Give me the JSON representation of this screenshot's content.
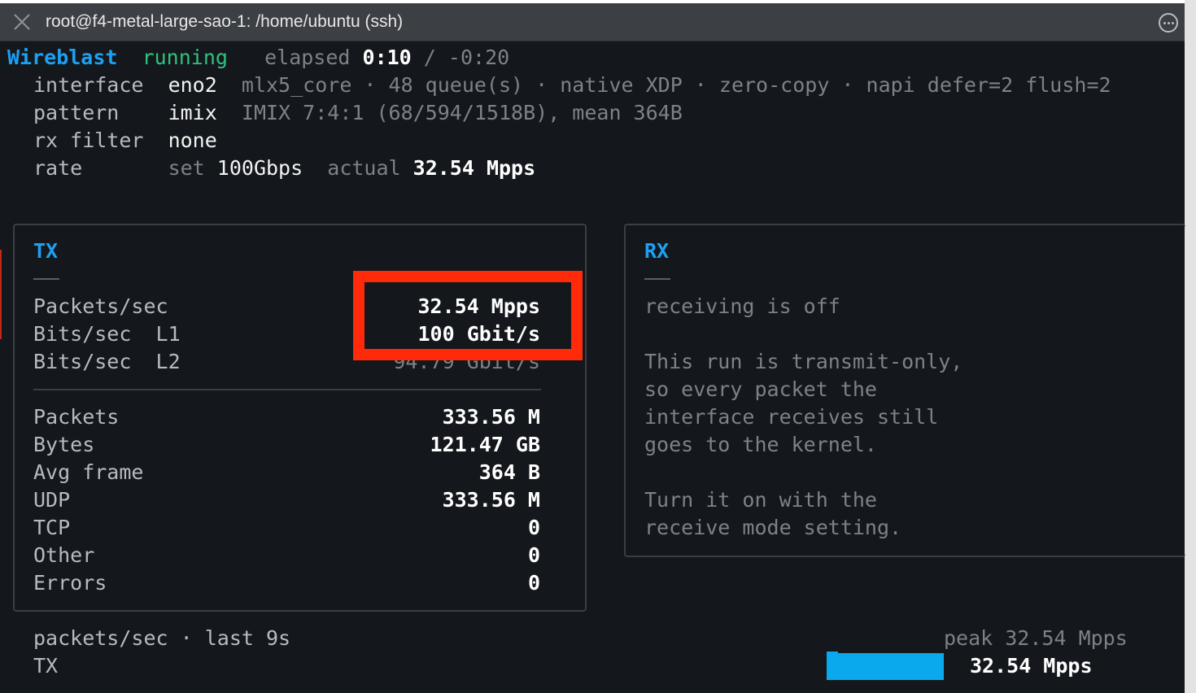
{
  "window": {
    "title": "root@f4-metal-large-sao-1: /home/ubuntu (ssh)"
  },
  "header": {
    "app": "Wireblast",
    "status": "running",
    "elapsed_label": "elapsed",
    "elapsed": "0:10",
    "sep": "/",
    "remaining": "-0:20"
  },
  "info": {
    "interface_label": "interface",
    "interface": "eno2",
    "interface_detail": "mlx5_core · 48 queue(s) · native XDP · zero-copy · napi defer=2 flush=2",
    "pattern_label": "pattern",
    "pattern": "imix",
    "pattern_detail": "IMIX 7:4:1 (68/594/1518B), mean 364B",
    "rx_filter_label": "rx filter",
    "rx_filter": "none",
    "rate_label": "rate",
    "rate_set_label": "set",
    "rate_set": "100Gbps",
    "rate_actual_label": "actual",
    "rate_actual": "32.54 Mpps"
  },
  "tx": {
    "title": "TX",
    "rates": [
      {
        "label": "Packets/sec",
        "value": "32.54 Mpps"
      },
      {
        "label": "Bits/sec  L1",
        "value": "100 Gbit/s"
      },
      {
        "label": "Bits/sec  L2",
        "value": "94.79 Gbit/s"
      }
    ],
    "counters": [
      {
        "label": "Packets",
        "value": "333.56 M"
      },
      {
        "label": "Bytes",
        "value": "121.47 GB"
      },
      {
        "label": "Avg frame",
        "value": "364 B"
      },
      {
        "label": "UDP",
        "value": "333.56 M"
      },
      {
        "label": "TCP",
        "value": "0"
      },
      {
        "label": "Other",
        "value": "0"
      },
      {
        "label": "Errors",
        "value": "0"
      }
    ]
  },
  "rx": {
    "title": "RX",
    "line1": "receiving is off",
    "para1": [
      "This run is transmit-only,",
      "so every packet the",
      "interface receives still",
      "goes to the kernel."
    ],
    "para2": [
      "Turn it on with the",
      "receive mode setting."
    ]
  },
  "graph": {
    "caption": "packets/sec · last 9s",
    "series_label": "TX",
    "peak": "peak 32.54 Mpps",
    "current": "32.54 Mpps",
    "bar_color": "#0aa9ee"
  },
  "colors": {
    "accent": "#1ea0f2",
    "running": "#2ec27e",
    "highlight": "#ff2a0a"
  }
}
